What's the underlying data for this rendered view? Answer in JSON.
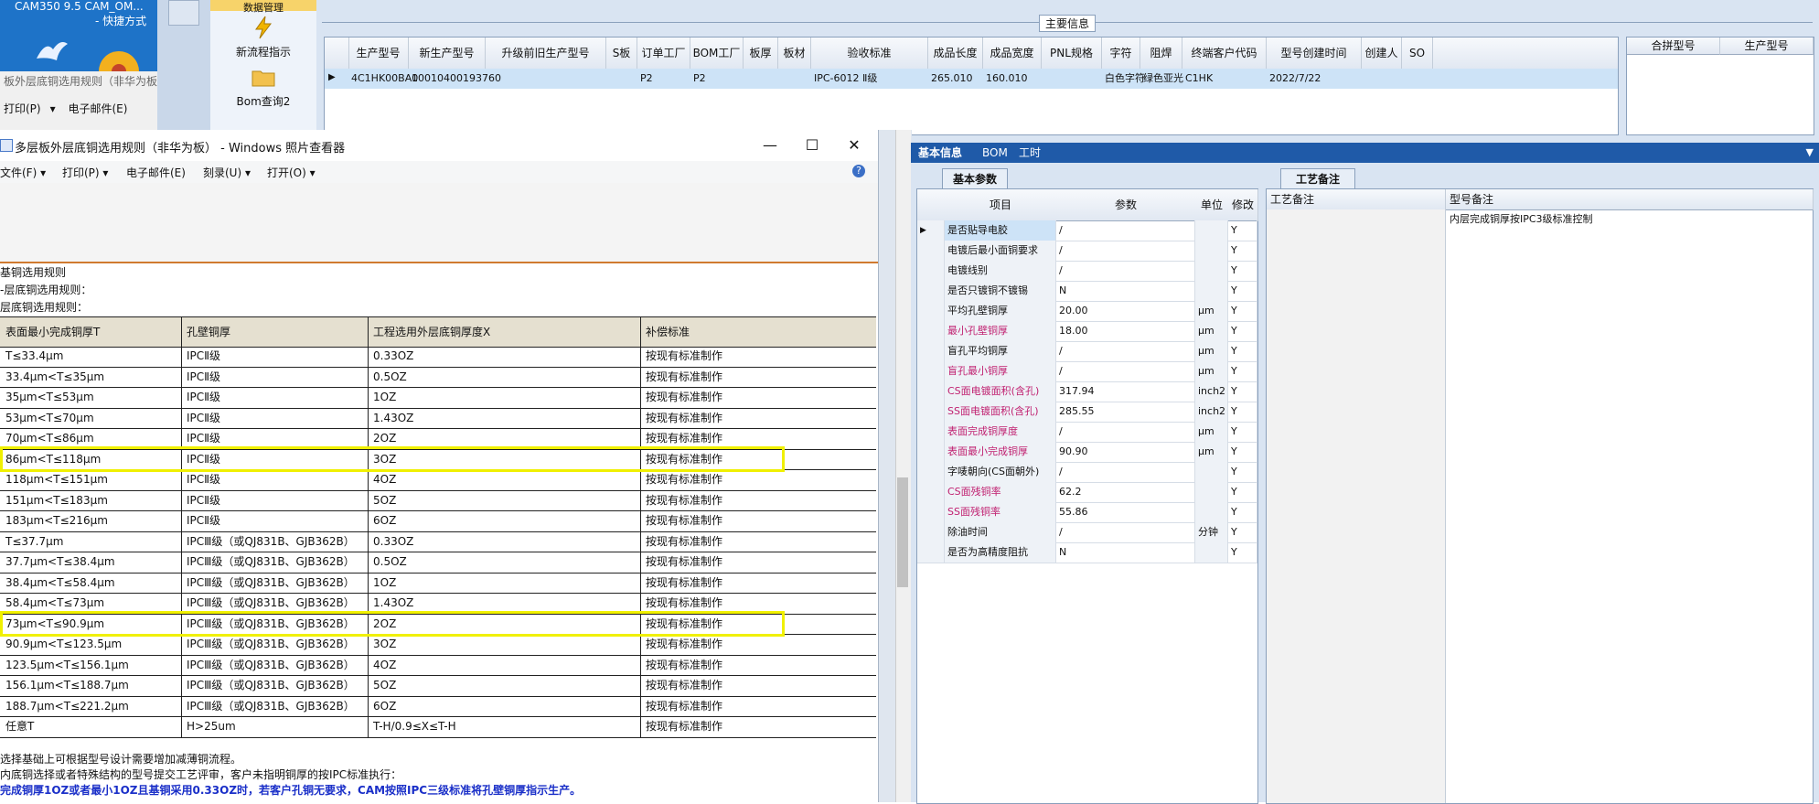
{
  "desktop": {
    "title1": "CAM350 9.5  CAM_OM...",
    "title2": "- 快捷方式",
    "bg_window_title": "板外层底铜选用规则（非华为板",
    "bg_window_menu": [
      "打印(P)",
      "电子邮件(E)"
    ],
    "icons": [
      "bird-icon",
      "flower-icon"
    ]
  },
  "cam_left": {
    "top_label": "数据管理",
    "items": [
      {
        "label": "新流程指示",
        "icon": "lightning-icon"
      },
      {
        "label": "Bom查询2",
        "icon": "folder-icon"
      }
    ]
  },
  "main_info": {
    "section_label": "主要信息",
    "columns": [
      "生产型号",
      "新生产型号",
      "升级前旧生产型号",
      "S板",
      "订单工厂",
      "BOM工厂",
      "板厚",
      "板材",
      "验收标准",
      "成品长度",
      "成品宽度",
      "PNL规格",
      "字符",
      "阻焊",
      "终端客户代码",
      "型号创建时间",
      "创建人",
      "SO"
    ],
    "row": {
      "生产型号": "4C1HK00BA0",
      "新生产型号": "10010400193760",
      "升级前旧生产型号": "",
      "S板": "",
      "订单工厂": "P2",
      "BOM工厂": "P2",
      "板厚": "",
      "板材": "",
      "验收标准": "IPC-6012 Ⅱ级",
      "成品长度": "265.010",
      "成品宽度": "160.010",
      "PNL规格": "",
      "字符": "白色字符",
      "阻焊": "绿色亚光",
      "终端客户代码": "C1HK",
      "型号创建时间": "2022/7/22",
      "创建人": "",
      "SO": ""
    },
    "merge_columns": [
      "合拼型号",
      "生产型号"
    ]
  },
  "viewer": {
    "title": "多层板外层底铜选用规则（非华为板） - Windows 照片查看器",
    "menu": [
      "文件(F)",
      "打印(P)",
      "电子邮件(E)",
      "刻录(U)",
      "打开(O)"
    ],
    "buttons": {
      "minimize": "—",
      "maximize": "☐",
      "close": "✕",
      "help": "?"
    },
    "rule_lines": [
      "基铜选用规则",
      "-层底铜选用规则：",
      "层底铜选用规则："
    ],
    "table_headers": [
      "表面最小完成铜厚T",
      "孔壁铜厚",
      "工程选用外层底铜厚度X",
      "补偿标准"
    ],
    "table_rows": [
      [
        "T≤33.4μm",
        "IPCⅡ级",
        "0.33OZ",
        "按现有标准制作"
      ],
      [
        "33.4μm<T≤35μm",
        "IPCⅡ级",
        "0.5OZ",
        "按现有标准制作"
      ],
      [
        "35μm<T≤53μm",
        "IPCⅡ级",
        "1OZ",
        "按现有标准制作"
      ],
      [
        "53μm<T≤70μm",
        "IPCⅡ级",
        "1.43OZ",
        "按现有标准制作"
      ],
      [
        "70μm<T≤86μm",
        "IPCⅡ级",
        "2OZ",
        "按现有标准制作"
      ],
      [
        "86μm<T≤118μm",
        "IPCⅡ级",
        "3OZ",
        "按现有标准制作"
      ],
      [
        "118μm<T≤151μm",
        "IPCⅡ级",
        "4OZ",
        "按现有标准制作"
      ],
      [
        "151μm<T≤183μm",
        "IPCⅡ级",
        "5OZ",
        "按现有标准制作"
      ],
      [
        "183μm<T≤216μm",
        "IPCⅡ级",
        "6OZ",
        "按现有标准制作"
      ],
      [
        "T≤37.7μm",
        "IPCⅢ级（或QJ831B、GJB362B）",
        "0.33OZ",
        "按现有标准制作"
      ],
      [
        "37.7μm<T≤38.4μm",
        "IPCⅢ级（或QJ831B、GJB362B）",
        "0.5OZ",
        "按现有标准制作"
      ],
      [
        "38.4μm<T≤58.4μm",
        "IPCⅢ级（或QJ831B、GJB362B）",
        "1OZ",
        "按现有标准制作"
      ],
      [
        "58.4μm<T≤73μm",
        "IPCⅢ级（或QJ831B、GJB362B）",
        "1.43OZ",
        "按现有标准制作"
      ],
      [
        "73μm<T≤90.9μm",
        "IPCⅢ级（或QJ831B、GJB362B）",
        "2OZ",
        "按现有标准制作"
      ],
      [
        "90.9μm<T≤123.5μm",
        "IPCⅢ级（或QJ831B、GJB362B）",
        "3OZ",
        "按现有标准制作"
      ],
      [
        "123.5μm<T≤156.1μm",
        "IPCⅢ级（或QJ831B、GJB362B）",
        "4OZ",
        "按现有标准制作"
      ],
      [
        "156.1μm<T≤188.7μm",
        "IPCⅢ级（或QJ831B、GJB362B）",
        "5OZ",
        "按现有标准制作"
      ],
      [
        "188.7μm<T≤221.2μm",
        "IPCⅢ级（或QJ831B、GJB362B）",
        "6OZ",
        "按现有标准制作"
      ],
      [
        "任意T",
        "H>25um",
        "T-H/0.9≤X≤T-H",
        "按现有标准制作"
      ]
    ],
    "highlighted_rows": [
      5,
      13
    ],
    "notes": [
      "选择基础上可根据型号设计需要增加减薄铜流程。",
      "内底铜选择或者特殊结构的型号提交工艺评审，客户未指明铜厚的按IPC标准执行：",
      "完成铜厚1OZ或者最小1OZ且基铜采用0.33OZ时，若客户孔铜无要求，CAM按照IPC三级标准将孔壁铜厚指示生产。"
    ]
  },
  "right_panel": {
    "tabs": [
      "基本信息",
      "BOM",
      "工时"
    ],
    "active_tab": "基本信息",
    "basic_params": {
      "title": "基本参数",
      "columns": [
        "项目",
        "参数",
        "单位",
        "修改"
      ],
      "rows": [
        {
          "item": "是否贴导电胶",
          "value": "/",
          "unit": "",
          "mod": "Y",
          "red": false
        },
        {
          "item": "电镀后最小面铜要求",
          "value": "/",
          "unit": "",
          "mod": "Y",
          "red": false
        },
        {
          "item": "电镀线别",
          "value": "/",
          "unit": "",
          "mod": "Y",
          "red": false
        },
        {
          "item": "是否只镀铜不镀锡",
          "value": "N",
          "unit": "",
          "mod": "Y",
          "red": false
        },
        {
          "item": "平均孔壁铜厚",
          "value": "20.00",
          "unit": "μm",
          "mod": "Y",
          "red": false
        },
        {
          "item": "最小孔壁铜厚",
          "value": "18.00",
          "unit": "μm",
          "mod": "Y",
          "red": true
        },
        {
          "item": "盲孔平均铜厚",
          "value": "/",
          "unit": "μm",
          "mod": "Y",
          "red": false
        },
        {
          "item": "盲孔最小铜厚",
          "value": "/",
          "unit": "μm",
          "mod": "Y",
          "red": true
        },
        {
          "item": "CS面电镀面积(含孔)",
          "value": "317.94",
          "unit": "inch2",
          "mod": "Y",
          "red": true
        },
        {
          "item": "SS面电镀面积(含孔)",
          "value": "285.55",
          "unit": "inch2",
          "mod": "Y",
          "red": true
        },
        {
          "item": "表面完成铜厚度",
          "value": "/",
          "unit": "μm",
          "mod": "Y",
          "red": true
        },
        {
          "item": "表面最小完成铜厚",
          "value": "90.90",
          "unit": "μm",
          "mod": "Y",
          "red": true
        },
        {
          "item": "字唛朝向(CS面朝外)",
          "value": "/",
          "unit": "",
          "mod": "Y",
          "red": false
        },
        {
          "item": "CS面残铜率",
          "value": "62.2",
          "unit": "",
          "mod": "Y",
          "red": true
        },
        {
          "item": "SS面残铜率",
          "value": "55.86",
          "unit": "",
          "mod": "Y",
          "red": true
        },
        {
          "item": "除油时间",
          "value": "/",
          "unit": "分钟",
          "mod": "Y",
          "red": false
        },
        {
          "item": "是否为高精度阻抗",
          "value": "N",
          "unit": "",
          "mod": "Y",
          "red": false
        }
      ]
    },
    "process_notes": {
      "title": "工艺备注",
      "columns": [
        "工艺备注",
        "型号备注"
      ],
      "model_note": "内层完成铜厚按IPC3级标准控制"
    }
  },
  "colors": {
    "accent_blue": "#1f5aa8",
    "highlight": "#f0f000",
    "row_select": "#cde3f7",
    "red_text": "#c02070",
    "note_blue": "#1a2fc8"
  }
}
